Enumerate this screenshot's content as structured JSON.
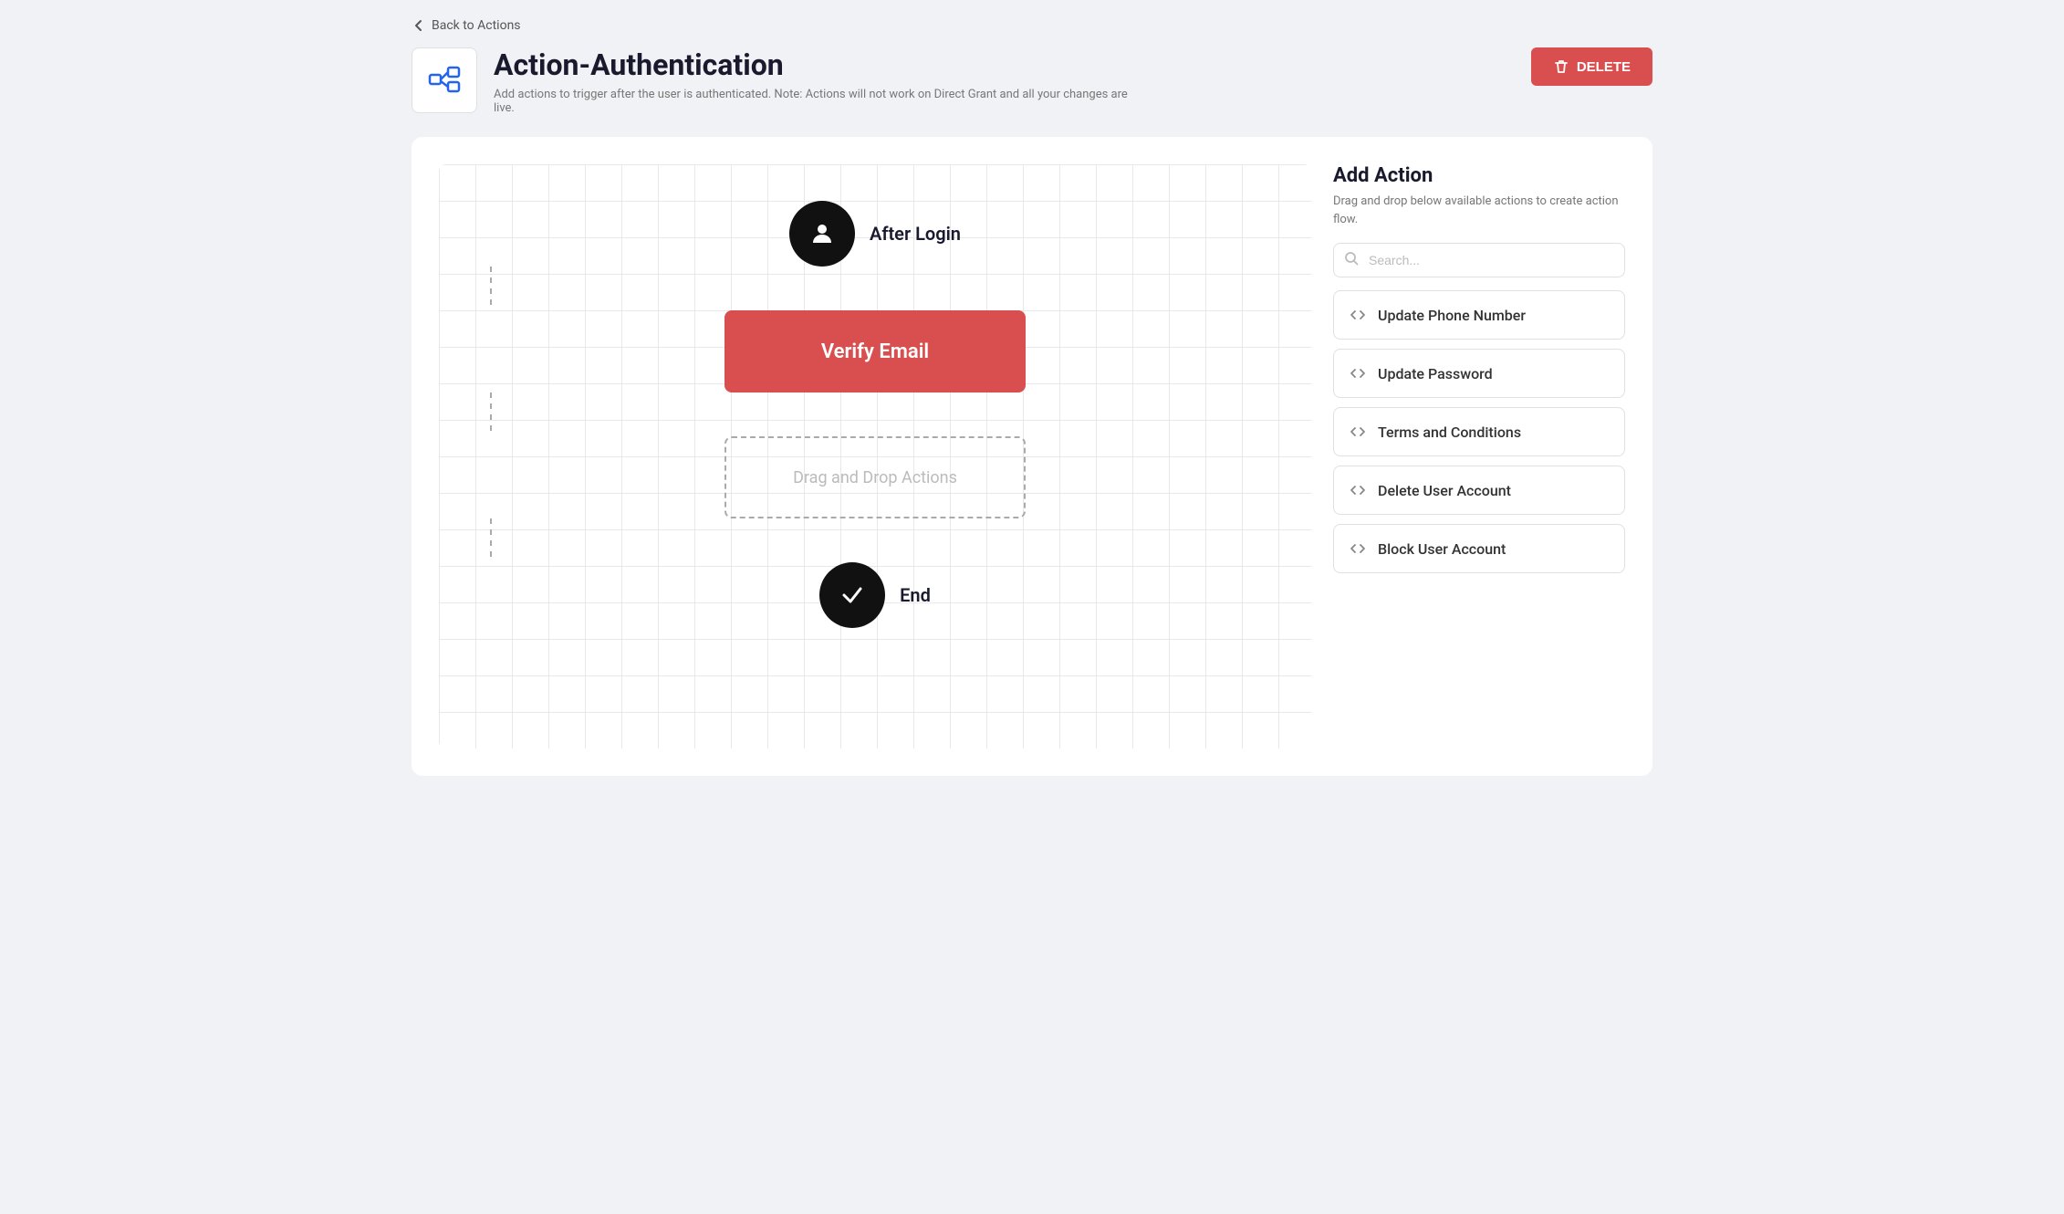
{
  "nav": {
    "back_label": "Back to Actions"
  },
  "header": {
    "title": "Action-Authentication",
    "description": "Add actions to trigger after the user is authenticated. Note: Actions will not work on Direct Grant and all your changes are live.",
    "delete_label": "DELETE"
  },
  "flow": {
    "start_node_label": "After Login",
    "action_node_label": "Verify Email",
    "drop_zone_label": "Drag and Drop Actions",
    "end_node_label": "End"
  },
  "sidebar": {
    "title": "Add Action",
    "subtitle": "Drag and drop below available actions to create action flow.",
    "search_placeholder": "Search...",
    "actions": [
      {
        "id": "update-phone",
        "label": "Update Phone Number"
      },
      {
        "id": "update-password",
        "label": "Update Password"
      },
      {
        "id": "terms-conditions",
        "label": "Terms and Conditions"
      },
      {
        "id": "delete-user",
        "label": "Delete User Account"
      },
      {
        "id": "block-user",
        "label": "Block User Account"
      }
    ]
  }
}
